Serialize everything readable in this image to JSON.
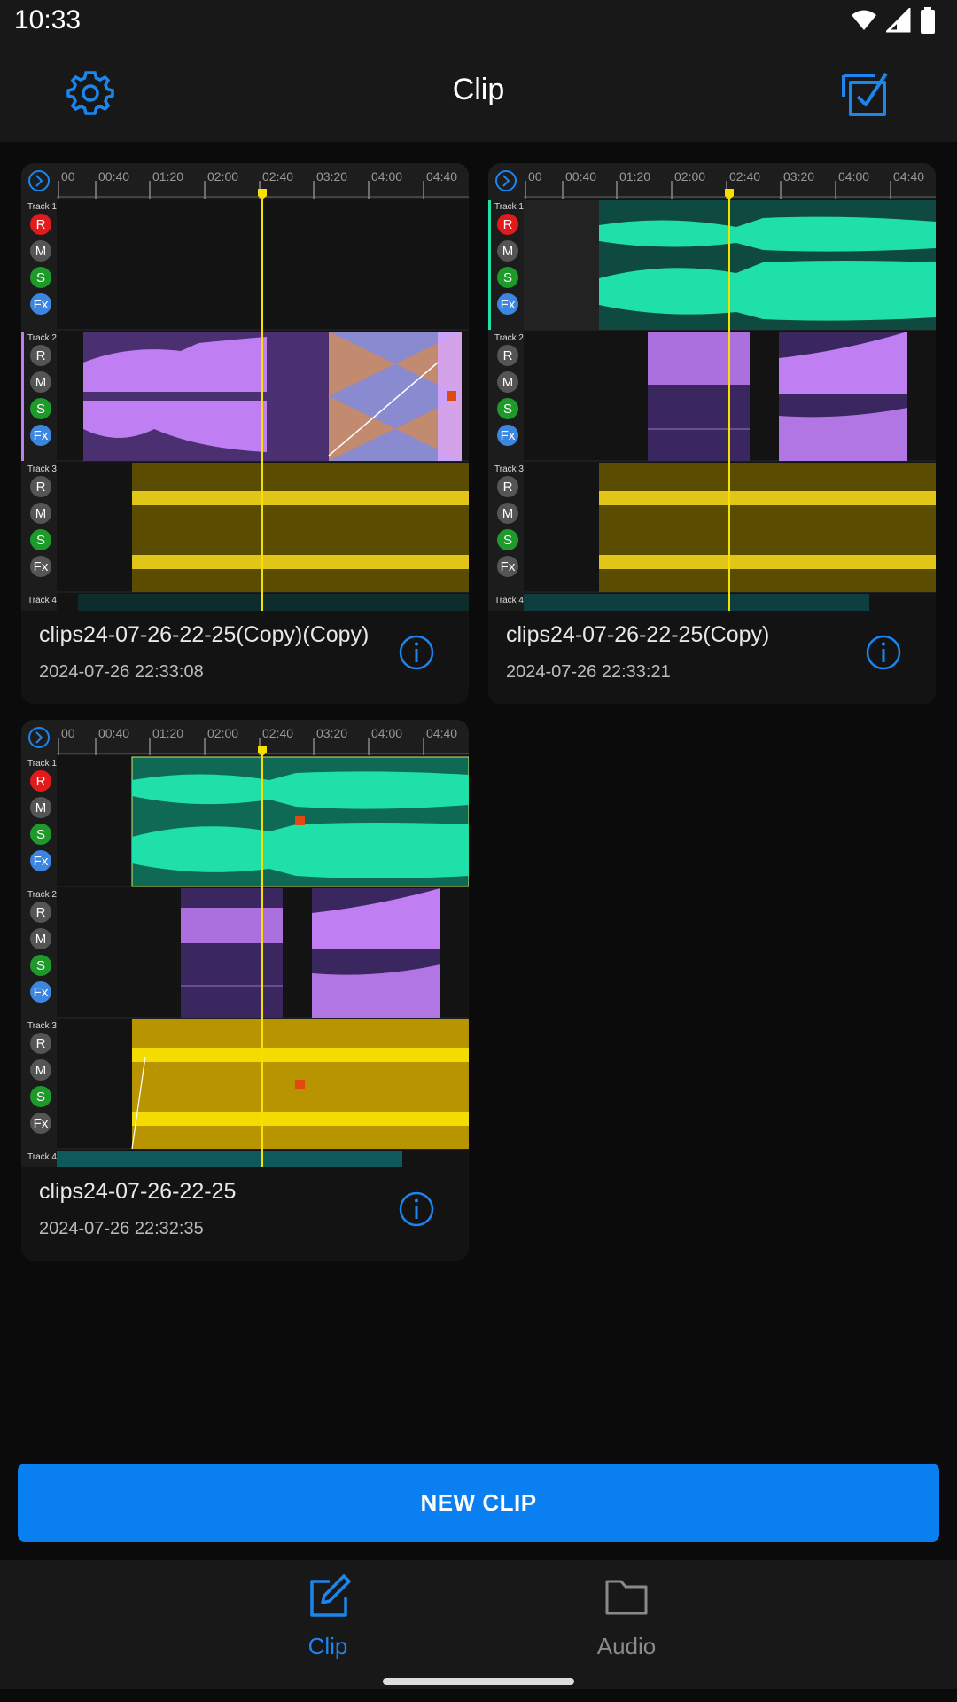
{
  "status_bar": {
    "time": "10:33"
  },
  "header": {
    "title": "Clip",
    "settings_icon": "gear-icon",
    "select_icon": "checkbox-select-icon",
    "accent_color": "#1a86f0"
  },
  "timeline": {
    "ticks": [
      "00",
      "00:40",
      "01:20",
      "02:00",
      "02:40",
      "03:20",
      "04:00",
      "04:40"
    ],
    "track_names": [
      "Track 1",
      "Track 2",
      "Track 3",
      "Track 4"
    ],
    "buttons": [
      "R",
      "M",
      "S",
      "Fx"
    ],
    "colors": {
      "track1": "#1fe0a8",
      "track2": "#c07ef3",
      "track3": "#f0d31a",
      "playhead": "#f5e000",
      "record": "#e11b1b",
      "solo": "#1e9a2a",
      "fx": "#3d86e0",
      "mute": "#555555"
    }
  },
  "clips": [
    {
      "name": "clips24-07-26-22-25(Copy)(Copy)",
      "date": "2024-07-26 22:33:08",
      "info_icon": "info-icon"
    },
    {
      "name": "clips24-07-26-22-25(Copy)",
      "date": "2024-07-26 22:33:21",
      "info_icon": "info-icon"
    },
    {
      "name": "clips24-07-26-22-25",
      "date": "2024-07-26 22:32:35",
      "info_icon": "info-icon"
    }
  ],
  "new_clip_button": "NEW CLIP",
  "bottom_nav": [
    {
      "label": "Clip",
      "icon": "edit-icon",
      "active": true
    },
    {
      "label": "Audio",
      "icon": "folder-icon",
      "active": false
    }
  ]
}
